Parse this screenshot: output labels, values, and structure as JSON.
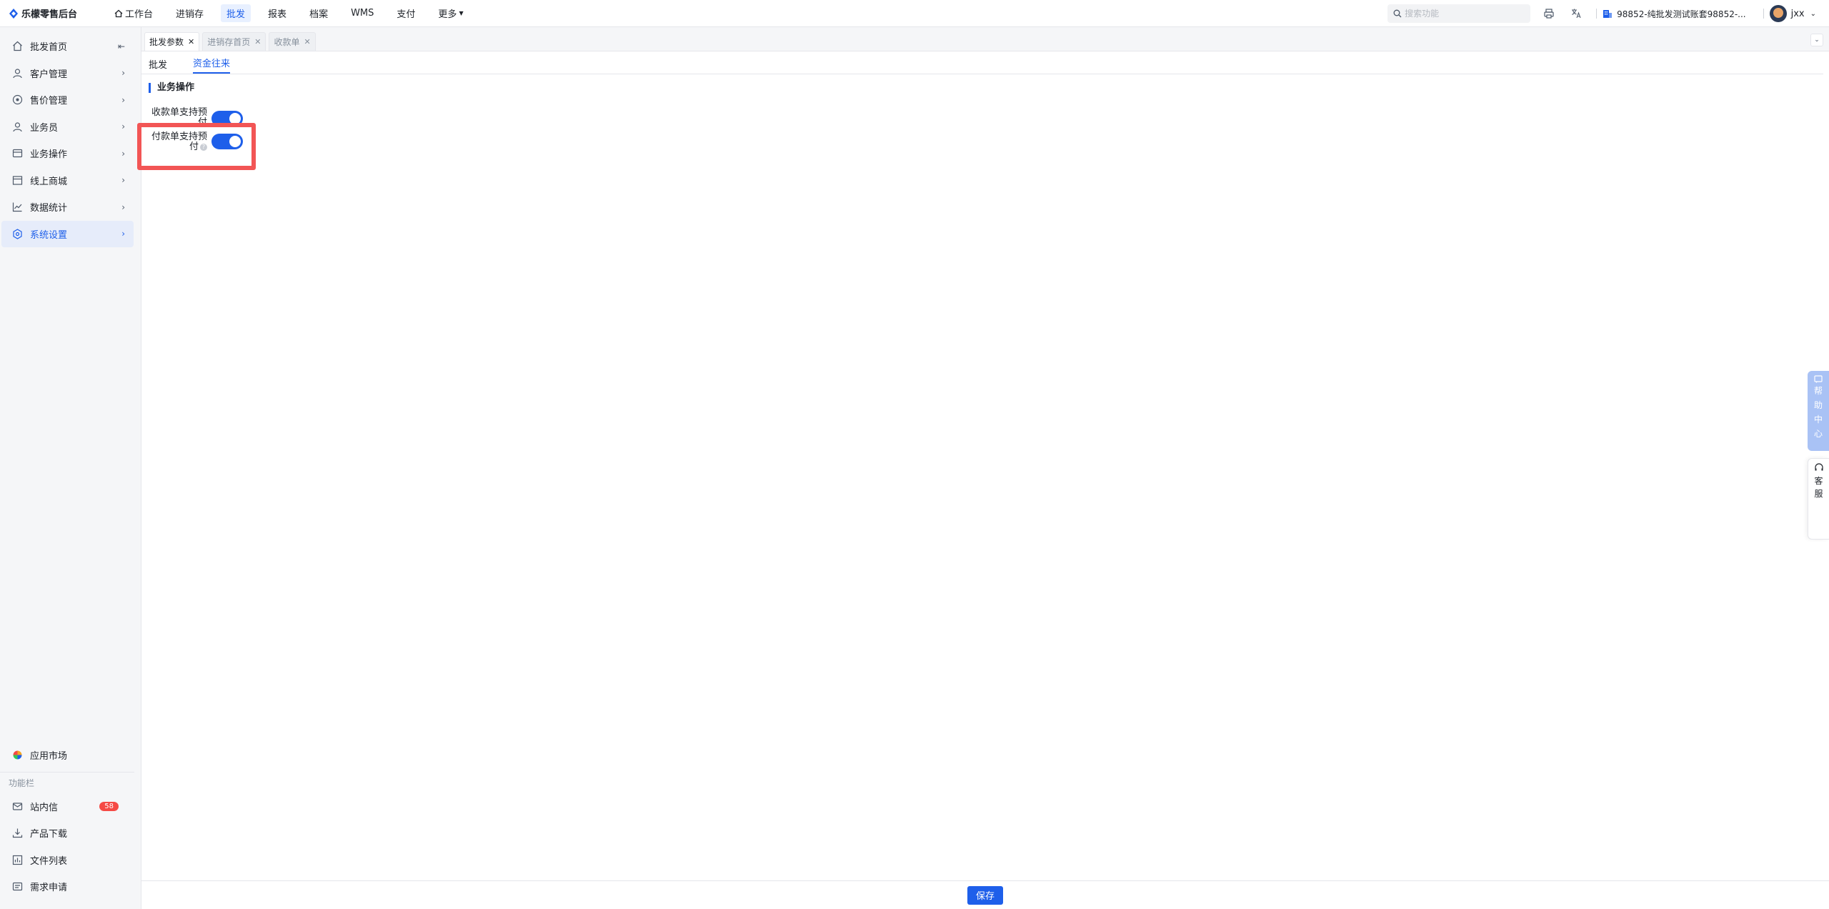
{
  "app": {
    "title": "乐檬零售后台"
  },
  "nav": {
    "items": [
      {
        "label": "工作台"
      },
      {
        "label": "进销存"
      },
      {
        "label": "批发"
      },
      {
        "label": "报表"
      },
      {
        "label": "档案"
      },
      {
        "label": "WMS"
      },
      {
        "label": "支付"
      },
      {
        "label": "更多"
      }
    ],
    "active": "批发"
  },
  "search": {
    "placeholder": "搜索功能"
  },
  "account": {
    "name": "98852-纯批发测试账套98852-..."
  },
  "user": {
    "name": "jxx"
  },
  "sidebar": {
    "items": [
      {
        "label": "批发首页"
      },
      {
        "label": "客户管理"
      },
      {
        "label": "售价管理"
      },
      {
        "label": "业务员"
      },
      {
        "label": "业务操作"
      },
      {
        "label": "线上商城"
      },
      {
        "label": "数据统计"
      },
      {
        "label": "系统设置"
      }
    ],
    "bottom": {
      "app_market": "应用市场",
      "section_label": "功能栏",
      "items": [
        {
          "label": "站内信",
          "badge": "58"
        },
        {
          "label": "产品下载"
        },
        {
          "label": "文件列表"
        },
        {
          "label": "需求申请"
        }
      ]
    }
  },
  "tabs": [
    {
      "label": "批发参数"
    },
    {
      "label": "进销存首页"
    },
    {
      "label": "收款单"
    }
  ],
  "subtabs": [
    {
      "label": "批发"
    },
    {
      "label": "资金往来"
    }
  ],
  "section": {
    "title": "业务操作"
  },
  "settings": [
    {
      "label_line1": "收款单支持预",
      "label_line2": "付",
      "enabled": true
    },
    {
      "label_line1": "付款单支持预",
      "label_line2": "付",
      "enabled": true
    }
  ],
  "footer": {
    "save_label": "保存"
  },
  "float": {
    "help_center": [
      "帮",
      "助",
      "中",
      "心"
    ],
    "service": [
      "客",
      "服"
    ]
  },
  "colors": {
    "accent": "#1e5fea",
    "highlight": "#f25555",
    "badge": "#f54a45"
  }
}
